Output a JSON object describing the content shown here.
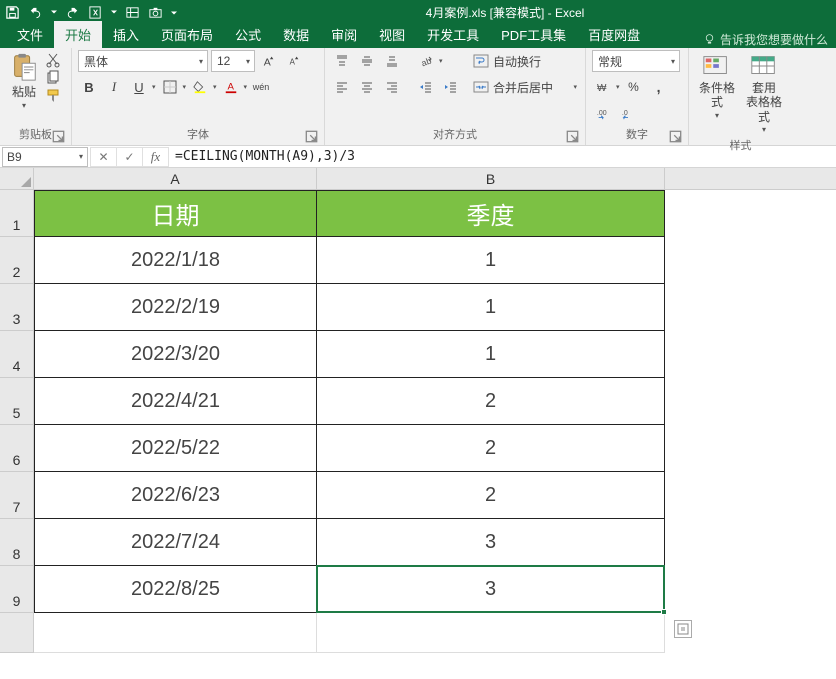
{
  "window": {
    "title": "4月案例.xls  [兼容模式] - Excel"
  },
  "tabs": {
    "file": "文件",
    "home": "开始",
    "insert": "插入",
    "layout": "页面布局",
    "formulas": "公式",
    "data": "数据",
    "review": "审阅",
    "view": "视图",
    "dev": "开发工具",
    "pdf": "PDF工具集",
    "baidu": "百度网盘",
    "tell_me": "告诉我您想要做什么"
  },
  "ribbon": {
    "clipboard": {
      "paste": "粘贴",
      "group": "剪贴板"
    },
    "font": {
      "name": "黑体",
      "size": "12",
      "group": "字体",
      "ruby": "wén"
    },
    "align": {
      "wrap": "自动换行",
      "merge": "合并后居中",
      "group": "对齐方式"
    },
    "number": {
      "format": "常规",
      "group": "数字"
    },
    "styles": {
      "cond": "条件格式",
      "table": "套用\n表格格式",
      "group": "样式"
    }
  },
  "namebox": "B9",
  "formula": "=CEILING(MONTH(A9),3)/3",
  "sheet": {
    "colA_header": "A",
    "colB_header": "B",
    "header": {
      "A": "日期",
      "B": "季度"
    },
    "rows": [
      {
        "n": "1"
      },
      {
        "n": "2",
        "A": "2022/1/18",
        "B": "1"
      },
      {
        "n": "3",
        "A": "2022/2/19",
        "B": "1"
      },
      {
        "n": "4",
        "A": "2022/3/20",
        "B": "1"
      },
      {
        "n": "5",
        "A": "2022/4/21",
        "B": "2"
      },
      {
        "n": "6",
        "A": "2022/5/22",
        "B": "2"
      },
      {
        "n": "7",
        "A": "2022/6/23",
        "B": "2"
      },
      {
        "n": "8",
        "A": "2022/7/24",
        "B": "3"
      },
      {
        "n": "9",
        "A": "2022/8/25",
        "B": "3"
      }
    ]
  }
}
